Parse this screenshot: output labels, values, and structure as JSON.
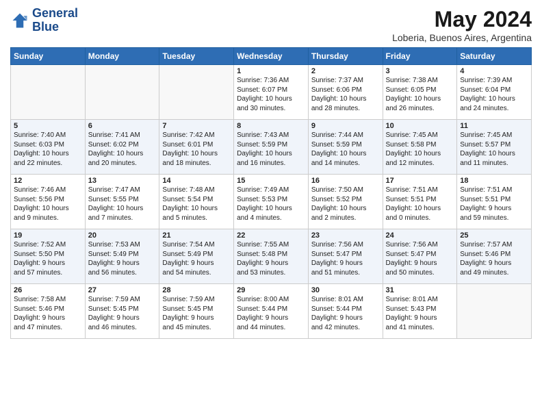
{
  "logo": {
    "line1": "General",
    "line2": "Blue"
  },
  "title": "May 2024",
  "subtitle": "Loberia, Buenos Aires, Argentina",
  "days_of_week": [
    "Sunday",
    "Monday",
    "Tuesday",
    "Wednesday",
    "Thursday",
    "Friday",
    "Saturday"
  ],
  "weeks": [
    [
      {
        "day": "",
        "info": ""
      },
      {
        "day": "",
        "info": ""
      },
      {
        "day": "",
        "info": ""
      },
      {
        "day": "1",
        "info": "Sunrise: 7:36 AM\nSunset: 6:07 PM\nDaylight: 10 hours\nand 30 minutes."
      },
      {
        "day": "2",
        "info": "Sunrise: 7:37 AM\nSunset: 6:06 PM\nDaylight: 10 hours\nand 28 minutes."
      },
      {
        "day": "3",
        "info": "Sunrise: 7:38 AM\nSunset: 6:05 PM\nDaylight: 10 hours\nand 26 minutes."
      },
      {
        "day": "4",
        "info": "Sunrise: 7:39 AM\nSunset: 6:04 PM\nDaylight: 10 hours\nand 24 minutes."
      }
    ],
    [
      {
        "day": "5",
        "info": "Sunrise: 7:40 AM\nSunset: 6:03 PM\nDaylight: 10 hours\nand 22 minutes."
      },
      {
        "day": "6",
        "info": "Sunrise: 7:41 AM\nSunset: 6:02 PM\nDaylight: 10 hours\nand 20 minutes."
      },
      {
        "day": "7",
        "info": "Sunrise: 7:42 AM\nSunset: 6:01 PM\nDaylight: 10 hours\nand 18 minutes."
      },
      {
        "day": "8",
        "info": "Sunrise: 7:43 AM\nSunset: 5:59 PM\nDaylight: 10 hours\nand 16 minutes."
      },
      {
        "day": "9",
        "info": "Sunrise: 7:44 AM\nSunset: 5:59 PM\nDaylight: 10 hours\nand 14 minutes."
      },
      {
        "day": "10",
        "info": "Sunrise: 7:45 AM\nSunset: 5:58 PM\nDaylight: 10 hours\nand 12 minutes."
      },
      {
        "day": "11",
        "info": "Sunrise: 7:45 AM\nSunset: 5:57 PM\nDaylight: 10 hours\nand 11 minutes."
      }
    ],
    [
      {
        "day": "12",
        "info": "Sunrise: 7:46 AM\nSunset: 5:56 PM\nDaylight: 10 hours\nand 9 minutes."
      },
      {
        "day": "13",
        "info": "Sunrise: 7:47 AM\nSunset: 5:55 PM\nDaylight: 10 hours\nand 7 minutes."
      },
      {
        "day": "14",
        "info": "Sunrise: 7:48 AM\nSunset: 5:54 PM\nDaylight: 10 hours\nand 5 minutes."
      },
      {
        "day": "15",
        "info": "Sunrise: 7:49 AM\nSunset: 5:53 PM\nDaylight: 10 hours\nand 4 minutes."
      },
      {
        "day": "16",
        "info": "Sunrise: 7:50 AM\nSunset: 5:52 PM\nDaylight: 10 hours\nand 2 minutes."
      },
      {
        "day": "17",
        "info": "Sunrise: 7:51 AM\nSunset: 5:51 PM\nDaylight: 10 hours\nand 0 minutes."
      },
      {
        "day": "18",
        "info": "Sunrise: 7:51 AM\nSunset: 5:51 PM\nDaylight: 9 hours\nand 59 minutes."
      }
    ],
    [
      {
        "day": "19",
        "info": "Sunrise: 7:52 AM\nSunset: 5:50 PM\nDaylight: 9 hours\nand 57 minutes."
      },
      {
        "day": "20",
        "info": "Sunrise: 7:53 AM\nSunset: 5:49 PM\nDaylight: 9 hours\nand 56 minutes."
      },
      {
        "day": "21",
        "info": "Sunrise: 7:54 AM\nSunset: 5:49 PM\nDaylight: 9 hours\nand 54 minutes."
      },
      {
        "day": "22",
        "info": "Sunrise: 7:55 AM\nSunset: 5:48 PM\nDaylight: 9 hours\nand 53 minutes."
      },
      {
        "day": "23",
        "info": "Sunrise: 7:56 AM\nSunset: 5:47 PM\nDaylight: 9 hours\nand 51 minutes."
      },
      {
        "day": "24",
        "info": "Sunrise: 7:56 AM\nSunset: 5:47 PM\nDaylight: 9 hours\nand 50 minutes."
      },
      {
        "day": "25",
        "info": "Sunrise: 7:57 AM\nSunset: 5:46 PM\nDaylight: 9 hours\nand 49 minutes."
      }
    ],
    [
      {
        "day": "26",
        "info": "Sunrise: 7:58 AM\nSunset: 5:46 PM\nDaylight: 9 hours\nand 47 minutes."
      },
      {
        "day": "27",
        "info": "Sunrise: 7:59 AM\nSunset: 5:45 PM\nDaylight: 9 hours\nand 46 minutes."
      },
      {
        "day": "28",
        "info": "Sunrise: 7:59 AM\nSunset: 5:45 PM\nDaylight: 9 hours\nand 45 minutes."
      },
      {
        "day": "29",
        "info": "Sunrise: 8:00 AM\nSunset: 5:44 PM\nDaylight: 9 hours\nand 44 minutes."
      },
      {
        "day": "30",
        "info": "Sunrise: 8:01 AM\nSunset: 5:44 PM\nDaylight: 9 hours\nand 42 minutes."
      },
      {
        "day": "31",
        "info": "Sunrise: 8:01 AM\nSunset: 5:43 PM\nDaylight: 9 hours\nand 41 minutes."
      },
      {
        "day": "",
        "info": ""
      }
    ]
  ]
}
